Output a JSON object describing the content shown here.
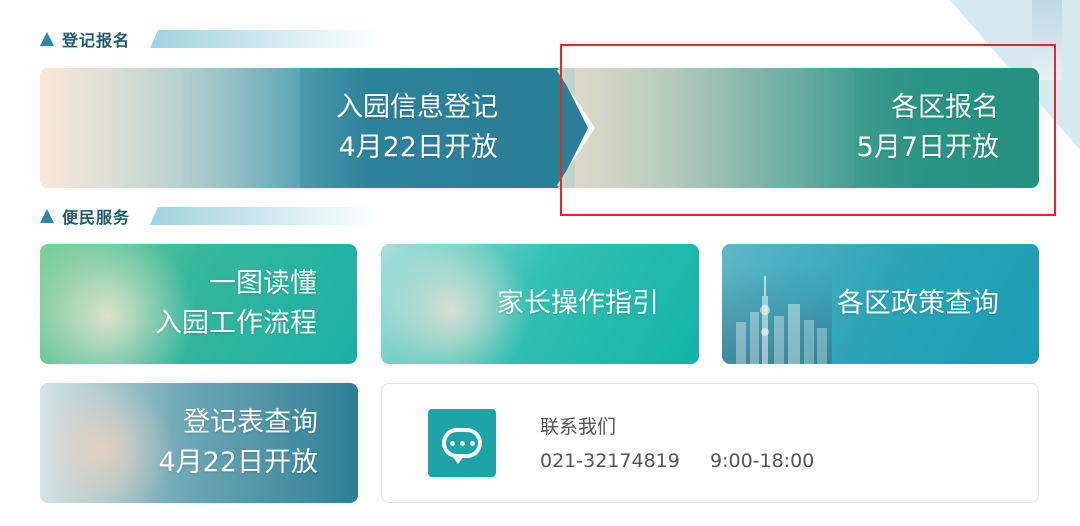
{
  "sections": {
    "registration": "登记报名",
    "services": "便民服务"
  },
  "cards": {
    "register": {
      "line1": "入园信息登记",
      "line2": "4月22日开放"
    },
    "apply": {
      "line1": "各区报名",
      "line2": "5月7日开放"
    },
    "flow": {
      "line1": "一图读懂",
      "line2": "入园工作流程"
    },
    "guide": {
      "line1": "家长操作指引"
    },
    "policy": {
      "line1": "各区政策查询"
    },
    "lookup": {
      "line1": "登记表查询",
      "line2": "4月22日开放"
    }
  },
  "contact": {
    "title": "联系我们",
    "phone": "021-32174819",
    "hours": "9:00-18:00",
    "icon": "chat-icon"
  },
  "colors": {
    "teal": "#2a8aa0",
    "green": "#2b9484",
    "highlight": "#e02a2a"
  }
}
